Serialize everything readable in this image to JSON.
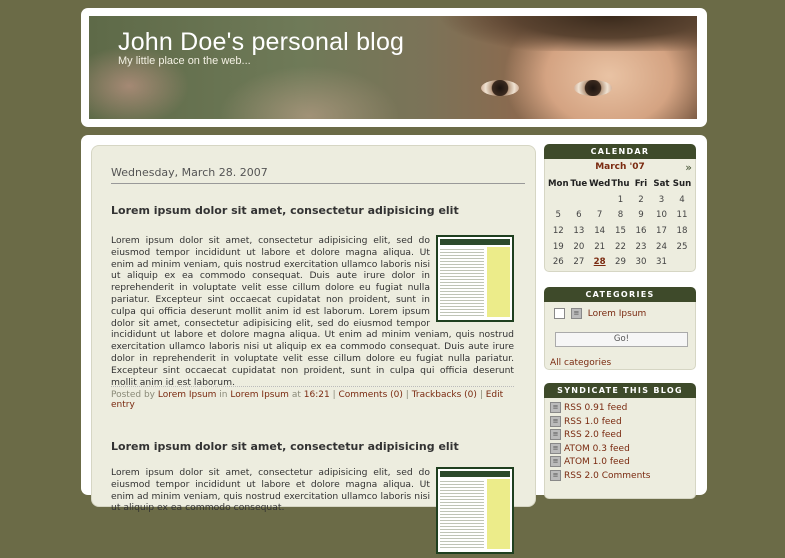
{
  "header": {
    "title": "John Doe's personal blog",
    "subtitle": "My little place on the web..."
  },
  "main": {
    "date": "Wednesday, March 28. 2007",
    "entries": [
      {
        "title": "Lorem ipsum dolor sit amet, consectetur adipisicing elit",
        "body": "Lorem ipsum dolor sit amet, consectetur adipisicing elit, sed do eiusmod tempor incididunt ut labore et dolore magna aliqua. Ut enim ad minim veniam, quis nostrud exercitation ullamco laboris nisi ut aliquip ex ea commodo consequat. Duis aute irure dolor in reprehenderit in voluptate velit esse cillum dolore eu fugiat nulla pariatur. Excepteur sint occaecat cupidatat non proident, sunt in culpa qui officia deserunt mollit anim id est laborum. Lorem ipsum dolor sit amet, consectetur adipisicing elit, sed do eiusmod tempor incididunt ut labore et dolore magna aliqua. Ut enim ad minim veniam, quis nostrud exercitation ullamco laboris nisi ut aliquip ex ea commodo consequat. Duis aute irure dolor in reprehenderit in voluptate velit esse cillum dolore eu fugiat nulla pariatur. Excepteur sint occaecat cupidatat non proident, sunt in culpa qui officia deserunt mollit anim id est laborum.",
        "footer": {
          "posted_by": "Posted by",
          "author": "Lorem Ipsum",
          "in": "in",
          "category": "Lorem Ipsum",
          "at": "at",
          "time": "16:21",
          "sep": "|",
          "comments": "Comments (0)",
          "trackbacks": "Trackbacks (0)",
          "edit": "Edit entry"
        }
      },
      {
        "title": "Lorem ipsum dolor sit amet, consectetur adipisicing elit",
        "body": "Lorem ipsum dolor sit amet, consectetur adipisicing elit, sed do eiusmod tempor incididunt ut labore et dolore magna aliqua. Ut enim ad minim veniam, quis nostrud exercitation ullamco laboris nisi ut aliquip ex ea commodo consequat."
      }
    ]
  },
  "sidebar": {
    "calendar": {
      "title": "CALENDAR",
      "month": "March '07",
      "next": "»",
      "weekdays": [
        "Mon",
        "Tue",
        "Wed",
        "Thu",
        "Fri",
        "Sat",
        "Sun"
      ],
      "weeks": [
        [
          "",
          "",
          "",
          "1",
          "2",
          "3",
          "4"
        ],
        [
          "5",
          "6",
          "7",
          "8",
          "9",
          "10",
          "11"
        ],
        [
          "12",
          "13",
          "14",
          "15",
          "16",
          "17",
          "18"
        ],
        [
          "19",
          "20",
          "21",
          "22",
          "23",
          "24",
          "25"
        ],
        [
          "26",
          "27",
          "28",
          "29",
          "30",
          "31",
          ""
        ]
      ],
      "today": "28"
    },
    "categories": {
      "title": "CATEGORIES",
      "item": "Lorem Ipsum",
      "go": "Go!",
      "all": "All categories"
    },
    "syndicate": {
      "title": "SYNDICATE THIS BLOG",
      "feeds": [
        "RSS 0.91 feed",
        "RSS 1.0 feed",
        "RSS 2.0 feed",
        "ATOM 0.3 feed",
        "ATOM 1.0 feed",
        "RSS 2.0 Comments"
      ]
    }
  },
  "colors": {
    "page_background": "#6b6b47",
    "panel": "#ededdf",
    "box_header": "#3e4a2a",
    "link": "#7a2a10"
  }
}
